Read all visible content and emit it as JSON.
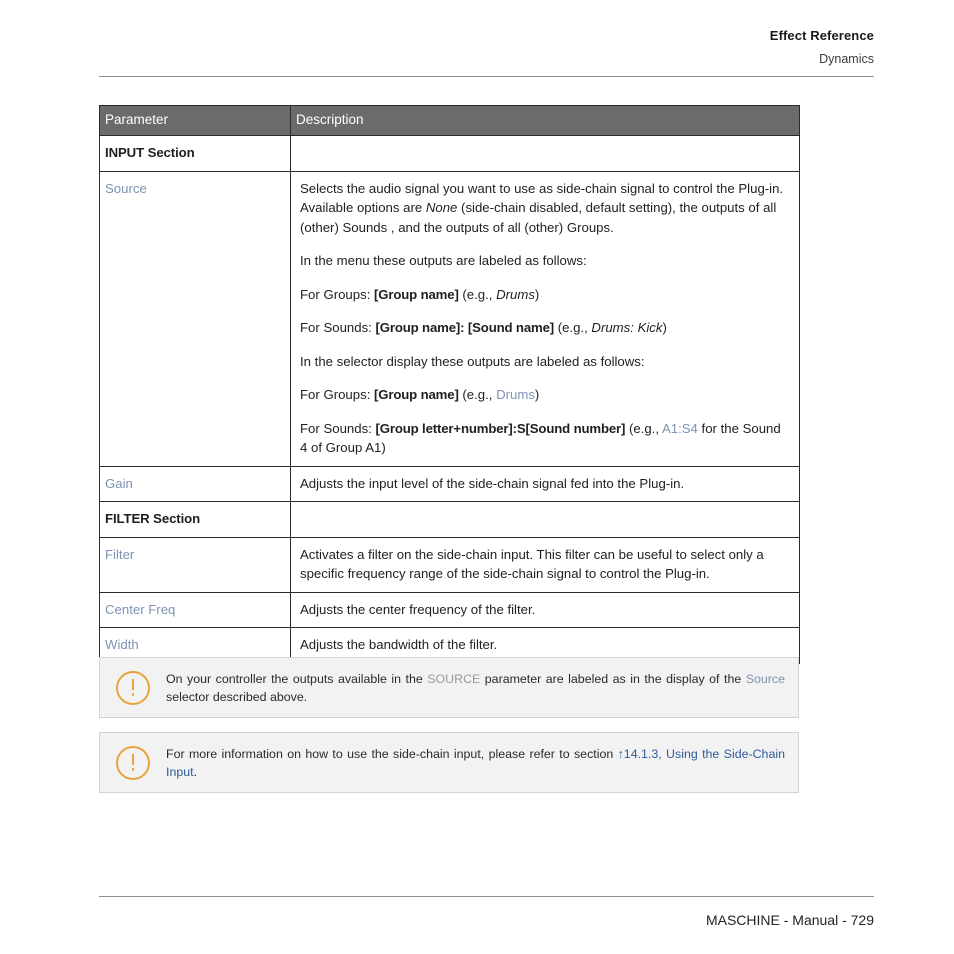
{
  "header": {
    "title": "Effect Reference",
    "subtitle": "Dynamics"
  },
  "table": {
    "columns": [
      "Parameter",
      "Description"
    ],
    "rows": [
      {
        "type": "section",
        "parameter": "INPUT Section",
        "description": ""
      },
      {
        "type": "param",
        "parameter": "Source",
        "paragraphs": [
          "Selects the audio signal you want to use as side-chain signal to control the Plug-in. Available options are None (side-chain disabled, default setting), the outputs of all (other) Sounds , and the outputs of all (other) Groups.",
          "In the menu these outputs are labeled as follows:",
          "For Groups: [Group name] (e.g., Drums)",
          "For Sounds: [Group name]: [Sound name] (e.g., Drums: Kick)",
          "In the selector display these outputs are labeled as follows:",
          "For Groups: [Group name] (e.g., Drums)",
          "For Sounds: [Group letter+number]:S[Sound number] (e.g., A1:S4 for the Sound 4 of Group A1)"
        ]
      },
      {
        "type": "param",
        "parameter": "Gain",
        "paragraphs": [
          "Adjusts the input level of the side-chain signal fed into the Plug-in."
        ]
      },
      {
        "type": "section",
        "parameter": "FILTER Section",
        "description": ""
      },
      {
        "type": "param",
        "parameter": "Filter",
        "paragraphs": [
          "Activates a filter on the side-chain input. This filter can be useful to select only a specific frequency range of the side-chain signal to control the Plug-in."
        ]
      },
      {
        "type": "param",
        "parameter": "Center Freq",
        "paragraphs": [
          "Adjusts the center frequency of the filter."
        ]
      },
      {
        "type": "param",
        "parameter": "Width",
        "paragraphs": [
          "Adjusts the bandwidth of the filter."
        ]
      }
    ],
    "source_cell": {
      "p1_a": "Selects the audio signal you want to use as side-chain signal to control the Plug-in. Available options are ",
      "p1_italic": "None",
      "p1_b": " (side-chain disabled, default setting), the outputs of all (other) Sounds , and the outputs of all (other) Groups.",
      "p2": "In the menu these outputs are labeled as follows:",
      "p3_a": "For Groups: ",
      "p3_bold": "[Group name]",
      "p3_b": " (e.g., ",
      "p3_italic": "Drums",
      "p3_c": ")",
      "p4_a": "For Sounds: ",
      "p4_bold": "[Group name]: [Sound name]",
      "p4_b": " (e.g., ",
      "p4_italic": "Drums: Kick",
      "p4_c": ")",
      "p5": "In the selector display these outputs are labeled as follows:",
      "p6_a": "For Groups: ",
      "p6_bold": "[Group name]",
      "p6_b": " (e.g., ",
      "p6_link": "Drums",
      "p6_c": ")",
      "p7_a": "For Sounds: ",
      "p7_bold": "[Group letter+number]:S[Sound number]",
      "p7_b": " (e.g., ",
      "p7_link": "A1:S4",
      "p7_c": " for the Sound 4 of Group A1)"
    }
  },
  "notes": [
    {
      "icon": "exclamation-circle-icon",
      "t1": "On your controller the outputs available in the ",
      "caps": "SOURCE",
      "t2": " parameter are labeled as in the display of the ",
      "link": "Source",
      "t3": " selector described above."
    },
    {
      "icon": "exclamation-circle-icon",
      "t1": "For more information on how to use the side-chain input, please refer to section ",
      "link": "↑14.1.3, Using the Side-Chain Input",
      "t3": "."
    }
  ],
  "footer": {
    "text": "MASCHINE - Manual - 729"
  },
  "colors": {
    "table_header_bg": "#6b6b6b",
    "param_link": "#7d93b4",
    "xref_link": "#2f5b9c",
    "note_bg": "#f2f2f2",
    "note_icon": "#e8a33d",
    "muted_caps": "#9a9a9a"
  }
}
